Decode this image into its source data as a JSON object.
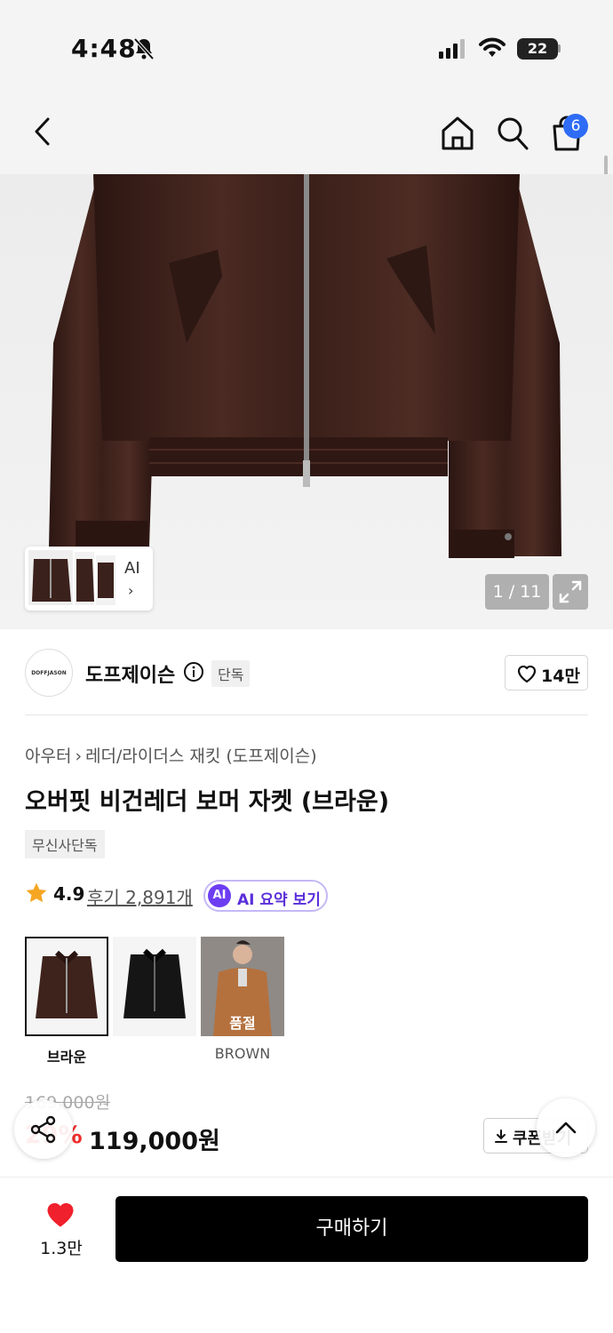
{
  "status_bar": {
    "time": "4:48",
    "battery": "22"
  },
  "nav": {
    "cart_count": "6"
  },
  "gallery": {
    "thumb_label": "AI",
    "counter": "1 / 11"
  },
  "brand": {
    "logo_text": "DOFFJASON",
    "name": "도프제이슨",
    "tag": "단독",
    "likes": "14만"
  },
  "product": {
    "breadcrumb": [
      "아우터",
      "레더/라이더스 재킷 (도프제이슨)"
    ],
    "title": "오버핏 비건레더 보머 자켓 (브라운)",
    "tag": "무신사단독",
    "rating": "4.9",
    "reviews": "후기 2,891개",
    "ai_badge": "AI",
    "ai_summary": "AI 요약 보기"
  },
  "options": [
    {
      "label": "브라운",
      "selected": true
    },
    {
      "label": "",
      "selected": false
    },
    {
      "label": "BROWN",
      "status": "품절"
    }
  ],
  "price": {
    "original": "169,000원",
    "discount": "29%",
    "sale": "119,000원",
    "coupon": "쿠폰받기"
  },
  "bottom": {
    "wish_count": "1.3만",
    "buy": "구매하기"
  },
  "colors": {
    "accent_blue": "#2e6cf6",
    "ai_purple": "#6d3df2",
    "sale_red": "#f02c2c",
    "heart_red": "#f0202c"
  }
}
